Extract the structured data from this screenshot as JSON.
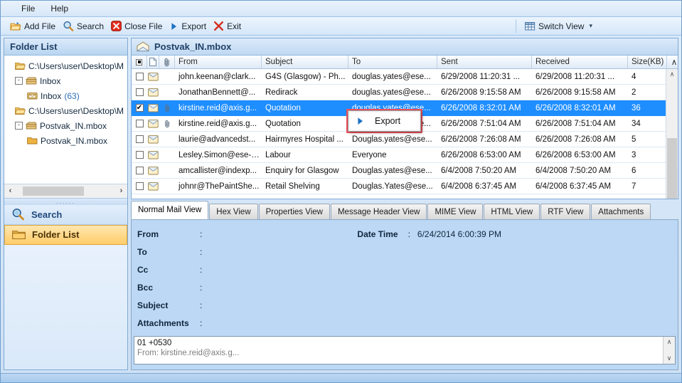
{
  "menubar": {
    "items": [
      "File",
      "Help"
    ]
  },
  "toolbar": {
    "items": [
      {
        "label": "Add File",
        "icon": "open-folder-icon"
      },
      {
        "label": "Search",
        "icon": "magnifier-icon"
      },
      {
        "label": "Close File",
        "icon": "red-x-circle-icon"
      },
      {
        "label": "Export",
        "icon": "blue-play-icon"
      },
      {
        "label": "Exit",
        "icon": "red-x-icon"
      }
    ],
    "switch_view": {
      "label": "Switch View",
      "icon": "grid-icon",
      "caret": "▾"
    }
  },
  "sidebar": {
    "header": "Folder List",
    "tree": [
      {
        "label": "C:\\Users\\user\\Desktop\\M",
        "indent": 1,
        "icon": "folder-open-icon",
        "toggle": "",
        "count": ""
      },
      {
        "label": "Inbox",
        "indent": 2,
        "icon": "store-icon",
        "toggle": "-",
        "count": ""
      },
      {
        "label": "Inbox",
        "indent": 3,
        "icon": "mail-folder-icon",
        "toggle": "",
        "count": "(63)"
      },
      {
        "label": "C:\\Users\\user\\Desktop\\M",
        "indent": 1,
        "icon": "folder-open-icon",
        "toggle": "",
        "count": ""
      },
      {
        "label": "Postvak_IN.mbox",
        "indent": 2,
        "icon": "store-icon",
        "toggle": "-",
        "count": ""
      },
      {
        "label": "Postvak_IN.mbox",
        "indent": 3,
        "icon": "folder-icon",
        "toggle": "",
        "count": ""
      }
    ],
    "hscroll": {
      "left": "‹",
      "right": "›"
    },
    "nav": [
      {
        "label": "Search",
        "icon": "magnifier-icon",
        "active": false
      },
      {
        "label": "Folder List",
        "icon": "folder-icon",
        "active": true
      }
    ]
  },
  "maillist": {
    "title": "Postvak_IN.mbox",
    "title_icon": "mail-open-icon",
    "columns": {
      "check": "▪",
      "status": "page-icon",
      "attach": "paperclip-icon",
      "from": "From",
      "subject": "Subject",
      "to": "To",
      "sent": "Sent",
      "received": "Received",
      "size": "Size(KB)",
      "end": "∧"
    },
    "rows": [
      {
        "checked": false,
        "attach": false,
        "from": "john.keenan@clark...",
        "subject": "G4S (Glasgow) - Ph...",
        "to": "douglas.yates@ese...",
        "sent": "6/29/2008 11:20:31 ...",
        "received": "6/29/2008 11:20:31 ...",
        "size": "4",
        "selected": false
      },
      {
        "checked": false,
        "attach": false,
        "from": "JonathanBennett@...",
        "subject": "Redirack",
        "to": "douglas.yates@ese...",
        "sent": "6/26/2008 9:15:58 AM",
        "received": "6/26/2008 9:15:58 AM",
        "size": "2",
        "selected": false
      },
      {
        "checked": true,
        "attach": true,
        "from": "kirstine.reid@axis.g...",
        "subject": "Quotation",
        "to": "douglas.yates@ese...",
        "sent": "6/26/2008 8:32:01 AM",
        "received": "6/26/2008 8:32:01 AM",
        "size": "36",
        "selected": true
      },
      {
        "checked": false,
        "attach": true,
        "from": "kirstine.reid@axis.g...",
        "subject": "Quotation",
        "to": "douglas.yates@ese...",
        "sent": "6/26/2008 7:51:04 AM",
        "received": "6/26/2008 7:51:04 AM",
        "size": "34",
        "selected": false
      },
      {
        "checked": false,
        "attach": false,
        "from": "laurie@advancedst...",
        "subject": "Hairmyres Hospital ...",
        "to": "Douglas.yates@ese...",
        "sent": "6/26/2008 7:26:08 AM",
        "received": "6/26/2008 7:26:08 AM",
        "size": "5",
        "selected": false
      },
      {
        "checked": false,
        "attach": false,
        "from": "Lesley.Simon@ese-s...",
        "subject": "Labour",
        "to": "Everyone",
        "sent": "6/26/2008 6:53:00 AM",
        "received": "6/26/2008 6:53:00 AM",
        "size": "3",
        "selected": false
      },
      {
        "checked": false,
        "attach": false,
        "from": "amcallister@indexp...",
        "subject": "Enquiry for Glasgow",
        "to": "Douglas.yates@ese...",
        "sent": "6/4/2008 7:50:20 AM",
        "received": "6/4/2008 7:50:20 AM",
        "size": "6",
        "selected": false
      },
      {
        "checked": false,
        "attach": false,
        "from": "johnr@ThePaintShe...",
        "subject": "Retail Shelving",
        "to": "Douglas.Yates@ese...",
        "sent": "6/4/2008 6:37:45 AM",
        "received": "6/4/2008 6:37:45 AM",
        "size": "7",
        "selected": false
      }
    ],
    "scroll": {
      "up": "∧",
      "down": "∨"
    }
  },
  "context_menu": {
    "items": [
      {
        "label": "Export",
        "icon": "blue-play-icon"
      }
    ]
  },
  "tabs": [
    {
      "label": "Normal Mail View",
      "active": true
    },
    {
      "label": "Hex View",
      "active": false
    },
    {
      "label": "Properties View",
      "active": false
    },
    {
      "label": "Message Header View",
      "active": false
    },
    {
      "label": "MIME View",
      "active": false
    },
    {
      "label": "HTML View",
      "active": false
    },
    {
      "label": "RTF View",
      "active": false
    },
    {
      "label": "Attachments",
      "active": false
    }
  ],
  "preview": {
    "fields": [
      {
        "label": "From",
        "colon": ":",
        "value": ""
      },
      {
        "label": "To",
        "colon": ":",
        "value": ""
      },
      {
        "label": "Cc",
        "colon": ":",
        "value": ""
      },
      {
        "label": "Bcc",
        "colon": ":",
        "value": ""
      },
      {
        "label": "Subject",
        "colon": ":",
        "value": ""
      },
      {
        "label": "Attachments",
        "colon": ":",
        "value": ""
      }
    ],
    "datetime_label": "Date Time",
    "datetime_colon": ":",
    "datetime_value": "6/24/2014 6:00:39 PM",
    "body_line1": "01 +0530",
    "body_line2": "From: kirstine.reid@axis.g...",
    "body_scroll": {
      "up": "∧",
      "down": "∨"
    }
  }
}
